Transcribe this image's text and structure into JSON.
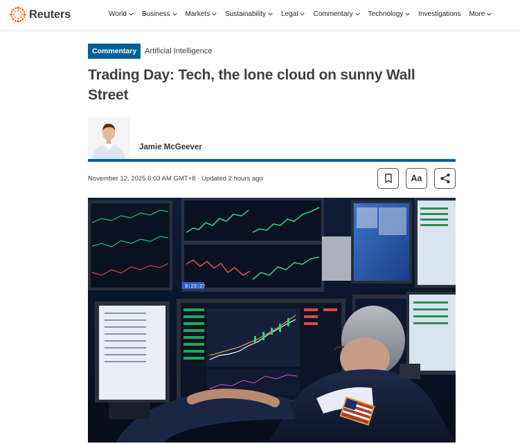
{
  "header": {
    "brand": "Reuters",
    "nav": [
      {
        "label": "World",
        "has_dropdown": true
      },
      {
        "label": "Business",
        "has_dropdown": true
      },
      {
        "label": "Markets",
        "has_dropdown": true
      },
      {
        "label": "Sustainability",
        "has_dropdown": true
      },
      {
        "label": "Legal",
        "has_dropdown": true
      },
      {
        "label": "Commentary",
        "has_dropdown": true
      },
      {
        "label": "Technology",
        "has_dropdown": true
      },
      {
        "label": "Investigations",
        "has_dropdown": false
      },
      {
        "label": "More",
        "has_dropdown": true
      }
    ]
  },
  "article": {
    "badge": "Commentary",
    "topic": "Artificial Intelligence",
    "headline": "Trading Day: Tech, the lone cloud on sunny Wall Street",
    "author": "Jamie McGeever",
    "dateline": "November 12, 2025 6:03 AM GMT+8 · Updated 2 hours ago",
    "tools": {
      "bookmark_icon": "bookmark-icon",
      "text_size_label": "Aa",
      "share_icon": "share-icon"
    }
  },
  "colors": {
    "brand_orange": "#fa6400",
    "accent_blue": "#005f99",
    "text": "#404040"
  }
}
